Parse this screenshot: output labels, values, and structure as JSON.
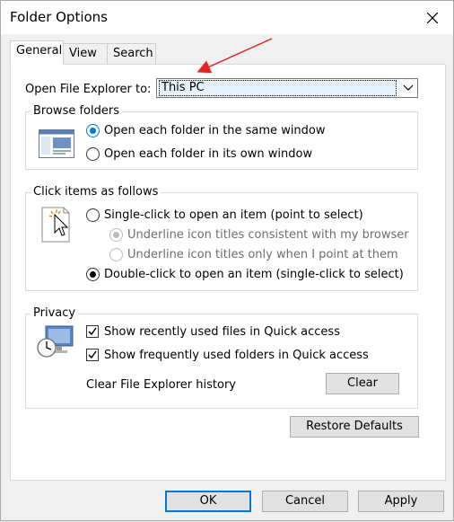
{
  "window": {
    "title": "Folder Options"
  },
  "tabs": [
    {
      "label": "General",
      "active": true
    },
    {
      "label": "View",
      "active": false
    },
    {
      "label": "Search",
      "active": false
    }
  ],
  "open_explorer": {
    "label": "Open File Explorer to:",
    "value": "This PC"
  },
  "browse_folders": {
    "title": "Browse folders",
    "options": [
      {
        "label": "Open each folder in the same window",
        "selected": true
      },
      {
        "label": "Open each folder in its own window",
        "selected": false
      }
    ]
  },
  "click_items": {
    "title": "Click items as follows",
    "single_click": {
      "label": "Single-click to open an item (point to select)",
      "selected": false
    },
    "underline_consistent": {
      "label": "Underline icon titles consistent with my browser",
      "selected": true,
      "disabled": true
    },
    "underline_point": {
      "label": "Underline icon titles only when I point at them",
      "selected": false,
      "disabled": true
    },
    "double_click": {
      "label": "Double-click to open an item (single-click to select)",
      "selected": true
    }
  },
  "privacy": {
    "title": "Privacy",
    "recent_files": {
      "label": "Show recently used files in Quick access",
      "checked": true
    },
    "frequent_folders": {
      "label": "Show frequently used folders in Quick access",
      "checked": true
    },
    "clear_history_label": "Clear File Explorer history",
    "clear_button": "Clear"
  },
  "restore_defaults": "Restore Defaults",
  "footer": {
    "ok": "OK",
    "cancel": "Cancel",
    "apply": "Apply"
  },
  "colors": {
    "accent": "#0078d7",
    "annotation_arrow": "#e0261e"
  }
}
